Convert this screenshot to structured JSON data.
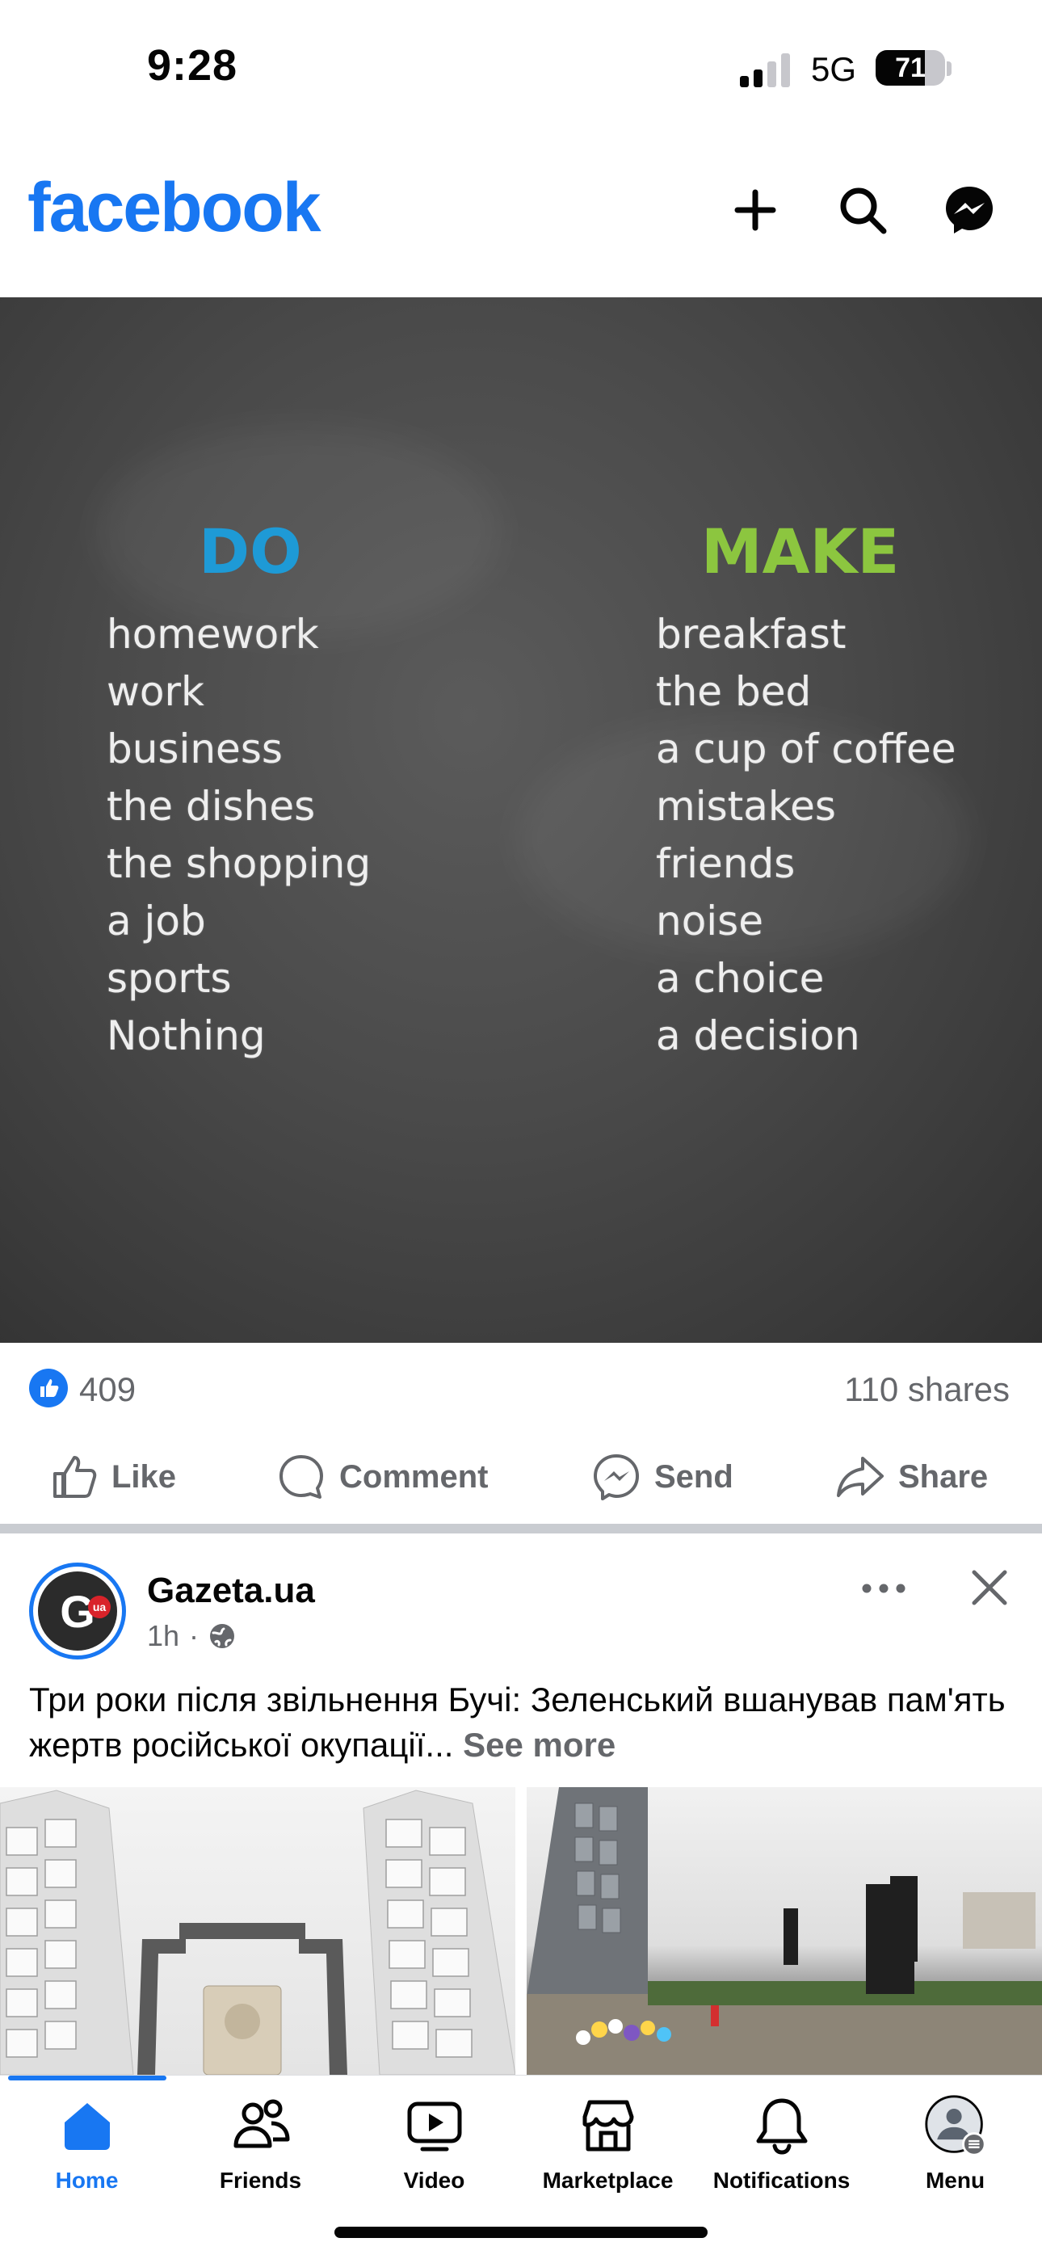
{
  "status_bar": {
    "time": "9:28",
    "network": "5G",
    "battery": "71",
    "battery_level": 0.71
  },
  "header": {
    "logo": "facebook",
    "icons": [
      "plus-icon",
      "search-icon",
      "messenger-icon"
    ]
  },
  "post1": {
    "image": {
      "left_heading": "DO",
      "right_heading": "MAKE",
      "left_heading_color": "#1e9ad6",
      "right_heading_color": "#8cc63f",
      "left_items": [
        "homework",
        "work",
        "business",
        "the dishes",
        "the shopping",
        "a job",
        "sports",
        "Nothing"
      ],
      "right_items": [
        "breakfast",
        "the bed",
        "a cup of coffee",
        "mistakes",
        "friends",
        "noise",
        "a choice",
        "a decision"
      ]
    },
    "like_count": "409",
    "shares": "110 shares",
    "actions": {
      "like": "Like",
      "comment": "Comment",
      "send": "Send",
      "share": "Share"
    }
  },
  "post2": {
    "page_name": "Gazeta.ua",
    "avatar_letter": "G",
    "avatar_badge": "ua",
    "time": "1h",
    "visibility_icon": "globe-icon",
    "text": "Три роки після звільнення Бучі: Зеленський вшанував пам'ять жертв російської окупації...",
    "see_more": "See more"
  },
  "tabbar": {
    "tabs": [
      {
        "label": "Home",
        "icon": "home-icon",
        "active": true
      },
      {
        "label": "Friends",
        "icon": "friends-icon",
        "active": false
      },
      {
        "label": "Video",
        "icon": "video-icon",
        "active": false
      },
      {
        "label": "Marketplace",
        "icon": "marketplace-icon",
        "active": false
      },
      {
        "label": "Notifications",
        "icon": "bell-icon",
        "active": false
      },
      {
        "label": "Menu",
        "icon": "profile-avatar",
        "active": false
      }
    ]
  },
  "colors": {
    "brand": "#1877f2",
    "muted": "#65676b"
  }
}
